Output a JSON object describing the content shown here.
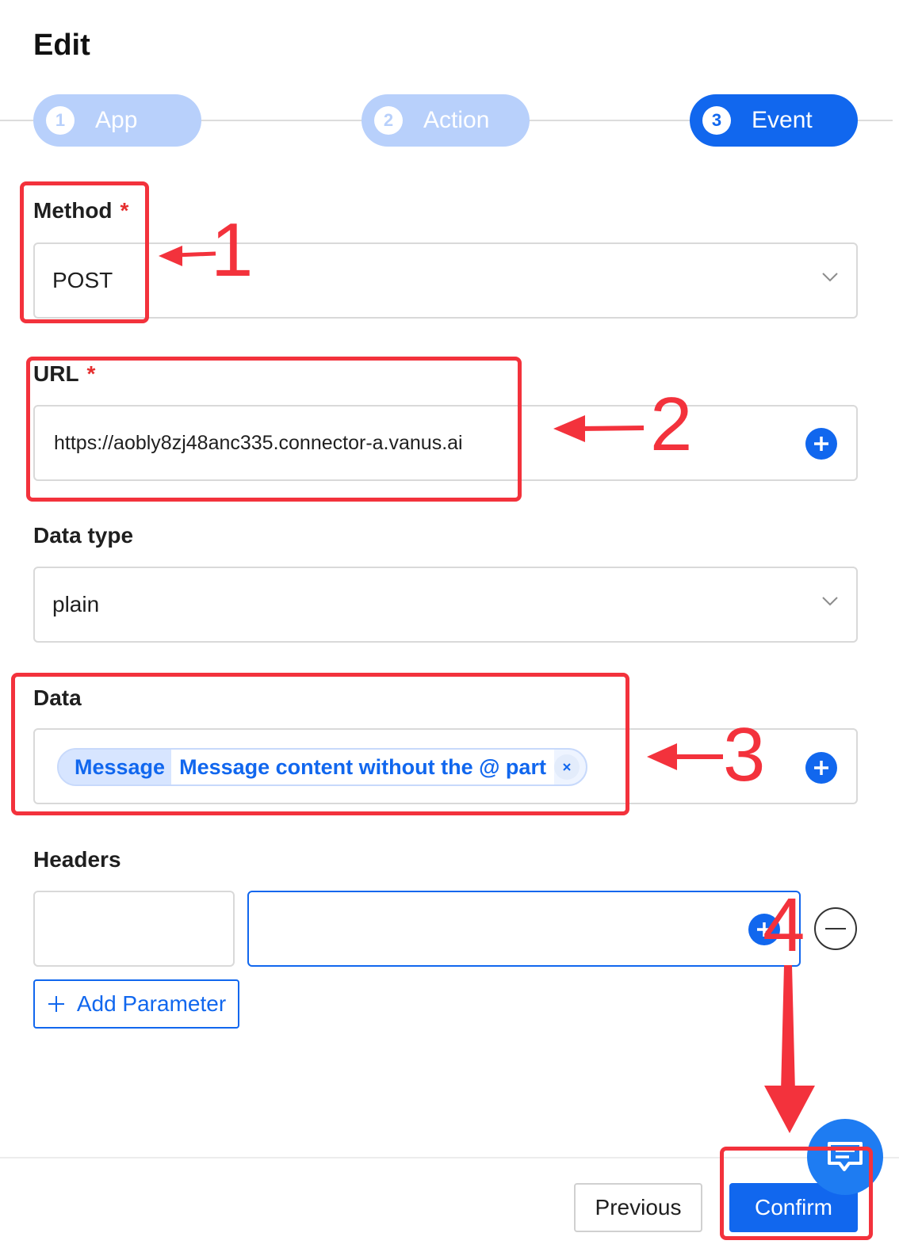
{
  "title": "Edit",
  "steps": [
    {
      "num": "1",
      "label": "App"
    },
    {
      "num": "2",
      "label": "Action"
    },
    {
      "num": "3",
      "label": "Event"
    }
  ],
  "method": {
    "label": "Method",
    "required": "*",
    "value": "POST"
  },
  "url": {
    "label": "URL",
    "required": "*",
    "value": "https://aobly8zj48anc335.connector-a.vanus.ai"
  },
  "data_type": {
    "label": "Data type",
    "value": "plain"
  },
  "data": {
    "label": "Data",
    "tag_key": "Message",
    "tag_value": "Message content without the @ part"
  },
  "headers": {
    "label": "Headers",
    "key_value": "",
    "val_value": ""
  },
  "add_parameter": {
    "label": "Add Parameter"
  },
  "buttons": {
    "previous": "Previous",
    "confirm": "Confirm"
  },
  "annotations": [
    "1",
    "2",
    "3",
    "4"
  ],
  "colors": {
    "primary": "#1167ee",
    "step_inactive": "#b8d0fb",
    "annotation": "#f3323c"
  },
  "icons": [
    "chevron-down-icon",
    "plus-circle-icon",
    "close-icon",
    "minus-circle-icon",
    "plus-icon",
    "chat-icon"
  ]
}
